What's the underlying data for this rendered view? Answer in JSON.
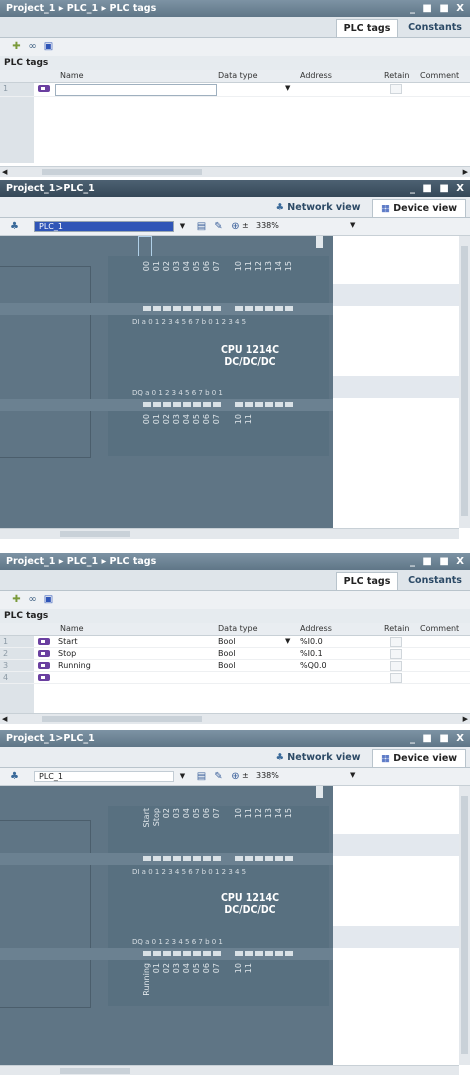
{
  "panels": [
    {
      "title": "Project_1 ▸ PLC_1 ▸ PLC tags",
      "tabs": [
        "PLC tags",
        "Constants"
      ],
      "section_title": "PLC tags",
      "columns": [
        "Name",
        "Data type",
        "Address",
        "Retain",
        "Comment"
      ],
      "rows": [
        {
          "num": "1",
          "name": "",
          "type": "",
          "address": ""
        }
      ]
    },
    {
      "title": "Project_1>PLC_1",
      "views": [
        "Network view",
        "Device view"
      ],
      "device": "PLC_1",
      "zoom": "338%",
      "cpu_line1": "CPU 1214C",
      "cpu_line2": "DC/DC/DC",
      "io_top": "DI a 0 1 2 3 4 5 6 7   b 0 1 2 3 4 5",
      "io_bottom": "DQ a 0 1 2 3 4 5 6 7   b 0 1",
      "pins_top": [
        "0",
        "1",
        "2",
        "3",
        "4",
        "5",
        "6",
        "7",
        "0",
        "1",
        "2",
        "3",
        "4",
        "5"
      ],
      "pins_bottom": [
        "0",
        "1",
        "2",
        "3",
        "4",
        "5",
        "6",
        "7",
        "0",
        "1"
      ]
    },
    {
      "title": "Project_1 ▸ PLC_1 ▸ PLC tags",
      "tabs": [
        "PLC tags",
        "Constants"
      ],
      "section_title": "PLC tags",
      "columns": [
        "Name",
        "Data type",
        "Address",
        "Retain",
        "Comment"
      ],
      "rows": [
        {
          "num": "1",
          "name": "Start",
          "type": "Bool",
          "address": "%I0.0"
        },
        {
          "num": "2",
          "name": "Stop",
          "type": "Bool",
          "address": "%I0.1"
        },
        {
          "num": "3",
          "name": "Running",
          "type": "Bool",
          "address": "%Q0.0"
        },
        {
          "num": "4",
          "name": "",
          "type": "",
          "address": ""
        }
      ]
    },
    {
      "title": "Project_1>PLC_1",
      "views": [
        "Network view",
        "Device view"
      ],
      "device": "PLC_1",
      "zoom": "338%",
      "cpu_line1": "CPU 1214C",
      "cpu_line2": "DC/DC/DC",
      "io_top": "DI a 0 1 2 3 4 5 6 7   b 0 1 2 3 4 5",
      "io_bottom": "DQ a 0 1 2 3 4 5 6 7   b 0 1",
      "pin_start": "Start",
      "pin_stop": "Stop",
      "pin_running": "Running"
    }
  ],
  "window_controls": "_ ■ ■ X"
}
